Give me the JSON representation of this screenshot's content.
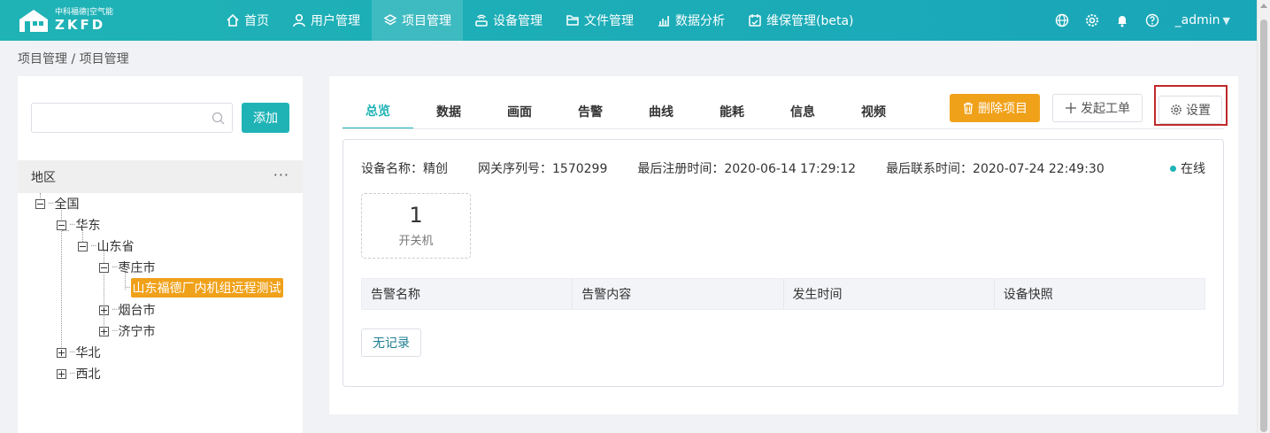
{
  "app": {
    "logo_cn": "中科福德|空气能",
    "logo_en": "ZKFD"
  },
  "nav": {
    "items": [
      {
        "label": "首页",
        "icon": "home-icon"
      },
      {
        "label": "用户管理",
        "icon": "user-icon"
      },
      {
        "label": "项目管理",
        "icon": "layers-icon",
        "active": true
      },
      {
        "label": "设备管理",
        "icon": "router-icon"
      },
      {
        "label": "文件管理",
        "icon": "folder-icon"
      },
      {
        "label": "数据分析",
        "icon": "chart-icon"
      },
      {
        "label": "维保管理(beta)",
        "icon": "calendar-icon"
      }
    ],
    "user": "_admin",
    "colors": {
      "primary": "#1fb3b6",
      "warning": "#f0a11a",
      "highlight": "#c0282a"
    }
  },
  "breadcrumb": "项目管理 / 项目管理",
  "left": {
    "search_placeholder": "",
    "add_label": "添加",
    "region_title": "地区",
    "region_more": "···",
    "tree": {
      "n1": "全国",
      "n2": "华东",
      "n3": "山东省",
      "n4": "枣庄市",
      "n5": "山东福德厂内机组远程测试",
      "n6": "烟台市",
      "n7": "济宁市",
      "n8": "华北",
      "n9": "西北"
    }
  },
  "main": {
    "tabs": [
      "总览",
      "数据",
      "画面",
      "告警",
      "曲线",
      "能耗",
      "信息",
      "视频"
    ],
    "delete_label": "删除项目",
    "order_label": "发起工单",
    "settings_label": "设置",
    "device_name": "设备名称：精创",
    "gateway_serial": "网关序列号：1570299",
    "last_register": "最后注册时间：2020-06-14 17:29:12",
    "last_contact": "最后联系时间：2020-07-24 22:49:30",
    "status": "在线",
    "metric_value": "1",
    "metric_label": "开关机",
    "alarm_columns": [
      "告警名称",
      "告警内容",
      "发生时间",
      "设备快照"
    ],
    "no_record": "无记录"
  }
}
